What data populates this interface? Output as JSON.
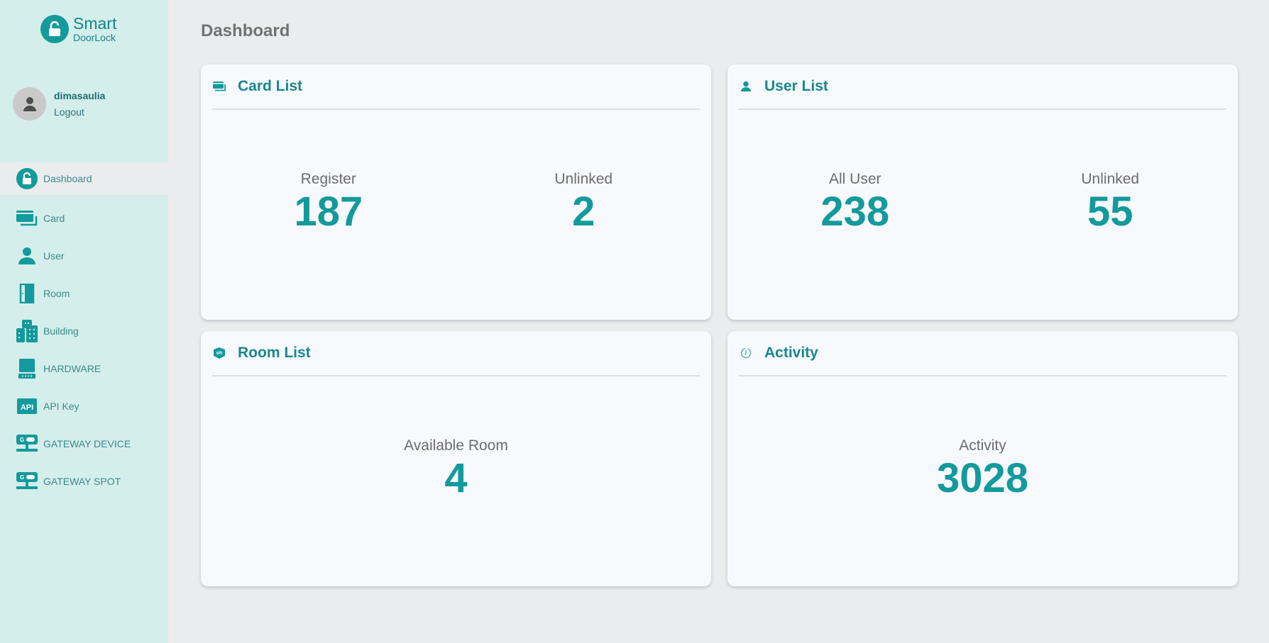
{
  "brand": {
    "line1": "Smart",
    "line2": "DoorLock",
    "accent": "#139a9c"
  },
  "user": {
    "name": "dimasaulia",
    "logout_label": "Logout"
  },
  "sidebar": {
    "items": [
      {
        "label": "Dashboard",
        "icon": "unlock-circle-icon",
        "active": true
      },
      {
        "label": "Card",
        "icon": "cards-icon"
      },
      {
        "label": "User",
        "icon": "user-icon"
      },
      {
        "label": "Room",
        "icon": "door-icon"
      },
      {
        "label": "Building",
        "icon": "building-icon"
      },
      {
        "label": "HARDWARE",
        "icon": "hardware-icon"
      },
      {
        "label": "API Key",
        "icon": "api-icon"
      },
      {
        "label": "GATEWAY DEVICE",
        "icon": "gateway-icon"
      },
      {
        "label": "GATEWAY SPOT",
        "icon": "gateway-icon"
      }
    ]
  },
  "page": {
    "title": "Dashboard"
  },
  "cards": {
    "card_list": {
      "title": "Card List",
      "stats": [
        {
          "label": "Register",
          "value": "187"
        },
        {
          "label": "Unlinked",
          "value": "2"
        }
      ]
    },
    "user_list": {
      "title": "User List",
      "stats": [
        {
          "label": "All User",
          "value": "238"
        },
        {
          "label": "Unlinked",
          "value": "55"
        }
      ]
    },
    "room_list": {
      "title": "Room List",
      "stats": [
        {
          "label": "Available Room",
          "value": "4"
        }
      ]
    },
    "activity": {
      "title": "Activity",
      "stats": [
        {
          "label": "Activity",
          "value": "3028"
        }
      ]
    }
  }
}
